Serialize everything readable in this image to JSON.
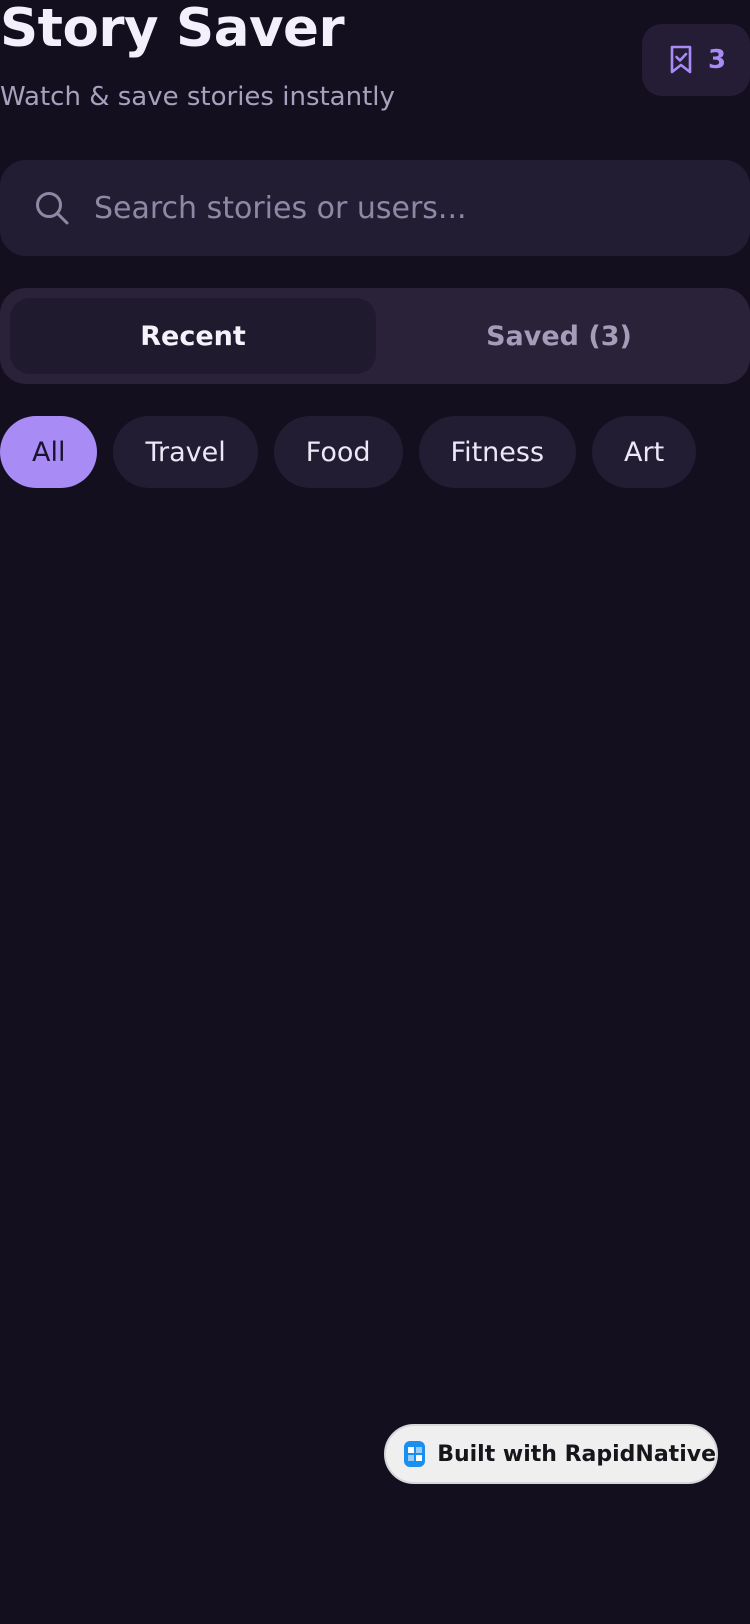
{
  "header": {
    "title": "Story Saver",
    "subtitle": "Watch & save stories instantly",
    "saved_badge": {
      "icon": "bookmark-check-icon",
      "count": "3"
    }
  },
  "search": {
    "placeholder": "Search stories or users...",
    "value": "",
    "icon": "search-icon"
  },
  "tabs": [
    {
      "label": "Recent",
      "active": true
    },
    {
      "label": "Saved (3)",
      "active": false
    }
  ],
  "categories": [
    {
      "label": "All",
      "active": true
    },
    {
      "label": "Travel",
      "active": false
    },
    {
      "label": "Food",
      "active": false
    },
    {
      "label": "Fitness",
      "active": false
    },
    {
      "label": "Art",
      "active": false
    }
  ],
  "footer_badge": {
    "label": "Built with RapidNative",
    "icon": "rapidnative-logo-icon"
  },
  "colors": {
    "background": "#130f1f",
    "accent": "#a98bf6",
    "surface": "#231d34"
  }
}
